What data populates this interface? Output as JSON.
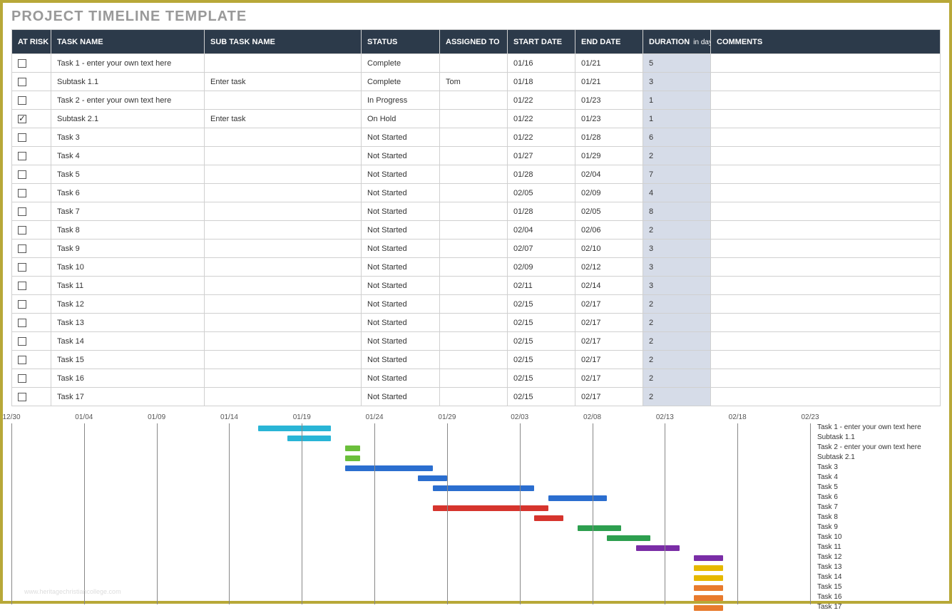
{
  "title": "PROJECT TIMELINE TEMPLATE",
  "columns": {
    "at_risk": "AT RISK",
    "task_name": "TASK NAME",
    "sub_task": "SUB TASK NAME",
    "status": "STATUS",
    "assigned_to": "ASSIGNED TO",
    "start_date": "START DATE",
    "end_date": "END DATE",
    "duration": "DURATION",
    "duration_unit": "in days",
    "comments": "COMMENTS"
  },
  "rows": [
    {
      "at_risk": false,
      "task": "Task 1 - enter your own text here",
      "sub": "",
      "status": "Complete",
      "assigned": "",
      "start": "01/16",
      "end": "01/21",
      "duration": "5",
      "comments": ""
    },
    {
      "at_risk": false,
      "task": "Subtask 1.1",
      "sub": "Enter task",
      "status": "Complete",
      "assigned": "Tom",
      "start": "01/18",
      "end": "01/21",
      "duration": "3",
      "comments": ""
    },
    {
      "at_risk": false,
      "task": "Task 2 - enter your own text here",
      "sub": "",
      "status": "In Progress",
      "assigned": "",
      "start": "01/22",
      "end": "01/23",
      "duration": "1",
      "comments": ""
    },
    {
      "at_risk": true,
      "task": "Subtask 2.1",
      "sub": "Enter task",
      "status": "On Hold",
      "assigned": "",
      "start": "01/22",
      "end": "01/23",
      "duration": "1",
      "comments": ""
    },
    {
      "at_risk": false,
      "task": "Task 3",
      "sub": "",
      "status": "Not Started",
      "assigned": "",
      "start": "01/22",
      "end": "01/28",
      "duration": "6",
      "comments": ""
    },
    {
      "at_risk": false,
      "task": "Task 4",
      "sub": "",
      "status": "Not Started",
      "assigned": "",
      "start": "01/27",
      "end": "01/29",
      "duration": "2",
      "comments": ""
    },
    {
      "at_risk": false,
      "task": "Task 5",
      "sub": "",
      "status": "Not Started",
      "assigned": "",
      "start": "01/28",
      "end": "02/04",
      "duration": "7",
      "comments": ""
    },
    {
      "at_risk": false,
      "task": "Task 6",
      "sub": "",
      "status": "Not Started",
      "assigned": "",
      "start": "02/05",
      "end": "02/09",
      "duration": "4",
      "comments": ""
    },
    {
      "at_risk": false,
      "task": "Task 7",
      "sub": "",
      "status": "Not Started",
      "assigned": "",
      "start": "01/28",
      "end": "02/05",
      "duration": "8",
      "comments": ""
    },
    {
      "at_risk": false,
      "task": "Task 8",
      "sub": "",
      "status": "Not Started",
      "assigned": "",
      "start": "02/04",
      "end": "02/06",
      "duration": "2",
      "comments": ""
    },
    {
      "at_risk": false,
      "task": "Task 9",
      "sub": "",
      "status": "Not Started",
      "assigned": "",
      "start": "02/07",
      "end": "02/10",
      "duration": "3",
      "comments": ""
    },
    {
      "at_risk": false,
      "task": "Task 10",
      "sub": "",
      "status": "Not Started",
      "assigned": "",
      "start": "02/09",
      "end": "02/12",
      "duration": "3",
      "comments": ""
    },
    {
      "at_risk": false,
      "task": "Task 11",
      "sub": "",
      "status": "Not Started",
      "assigned": "",
      "start": "02/11",
      "end": "02/14",
      "duration": "3",
      "comments": ""
    },
    {
      "at_risk": false,
      "task": "Task 12",
      "sub": "",
      "status": "Not Started",
      "assigned": "",
      "start": "02/15",
      "end": "02/17",
      "duration": "2",
      "comments": ""
    },
    {
      "at_risk": false,
      "task": "Task 13",
      "sub": "",
      "status": "Not Started",
      "assigned": "",
      "start": "02/15",
      "end": "02/17",
      "duration": "2",
      "comments": ""
    },
    {
      "at_risk": false,
      "task": "Task 14",
      "sub": "",
      "status": "Not Started",
      "assigned": "",
      "start": "02/15",
      "end": "02/17",
      "duration": "2",
      "comments": ""
    },
    {
      "at_risk": false,
      "task": "Task 15",
      "sub": "",
      "status": "Not Started",
      "assigned": "",
      "start": "02/15",
      "end": "02/17",
      "duration": "2",
      "comments": ""
    },
    {
      "at_risk": false,
      "task": "Task 16",
      "sub": "",
      "status": "Not Started",
      "assigned": "",
      "start": "02/15",
      "end": "02/17",
      "duration": "2",
      "comments": ""
    },
    {
      "at_risk": false,
      "task": "Task 17",
      "sub": "",
      "status": "Not Started",
      "assigned": "",
      "start": "02/15",
      "end": "02/17",
      "duration": "2",
      "comments": ""
    }
  ],
  "chart_data": {
    "type": "gantt",
    "timescale": {
      "start": "12/30",
      "end": "02/23",
      "ticks": [
        "12/30",
        "01/04",
        "01/09",
        "01/14",
        "01/19",
        "01/24",
        "01/29",
        "02/03",
        "02/08",
        "02/13",
        "02/18",
        "02/23"
      ]
    },
    "tasks": [
      {
        "label": "Task 1 - enter your own text here",
        "start": "01/16",
        "end": "01/21",
        "color": "#29b5d6"
      },
      {
        "label": "Subtask 1.1",
        "start": "01/18",
        "end": "01/21",
        "color": "#29b5d6"
      },
      {
        "label": "Task 2 - enter your own text here",
        "start": "01/22",
        "end": "01/23",
        "color": "#6bbf3b"
      },
      {
        "label": "Subtask 2.1",
        "start": "01/22",
        "end": "01/23",
        "color": "#6bbf3b"
      },
      {
        "label": "Task 3",
        "start": "01/22",
        "end": "01/28",
        "color": "#2b6ecf"
      },
      {
        "label": "Task 4",
        "start": "01/27",
        "end": "01/29",
        "color": "#2b6ecf"
      },
      {
        "label": "Task 5",
        "start": "01/28",
        "end": "02/04",
        "color": "#2b6ecf"
      },
      {
        "label": "Task 6",
        "start": "02/05",
        "end": "02/09",
        "color": "#2b6ecf"
      },
      {
        "label": "Task 7",
        "start": "01/28",
        "end": "02/05",
        "color": "#d6342d"
      },
      {
        "label": "Task 8",
        "start": "02/04",
        "end": "02/06",
        "color": "#d6342d"
      },
      {
        "label": "Task 9",
        "start": "02/07",
        "end": "02/10",
        "color": "#2d9f4f"
      },
      {
        "label": "Task 10",
        "start": "02/09",
        "end": "02/12",
        "color": "#2d9f4f"
      },
      {
        "label": "Task 11",
        "start": "02/11",
        "end": "02/14",
        "color": "#7a2da6"
      },
      {
        "label": "Task 12",
        "start": "02/15",
        "end": "02/17",
        "color": "#7a2da6"
      },
      {
        "label": "Task 13",
        "start": "02/15",
        "end": "02/17",
        "color": "#e6b800"
      },
      {
        "label": "Task 14",
        "start": "02/15",
        "end": "02/17",
        "color": "#e6b800"
      },
      {
        "label": "Task 15",
        "start": "02/15",
        "end": "02/17",
        "color": "#e87b2d"
      },
      {
        "label": "Task 16",
        "start": "02/15",
        "end": "02/17",
        "color": "#e87b2d"
      },
      {
        "label": "Task 17",
        "start": "02/15",
        "end": "02/17",
        "color": "#e87b2d"
      }
    ]
  },
  "watermark": "www.heritagechristiancollege.com"
}
